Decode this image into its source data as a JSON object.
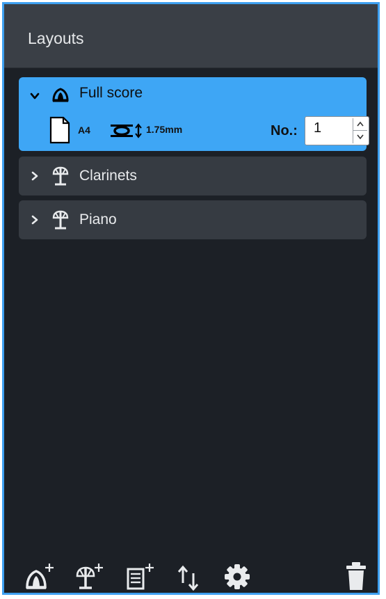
{
  "panel": {
    "title": "Layouts"
  },
  "layouts": [
    {
      "name": "Full score",
      "expanded": true,
      "selected": true,
      "icon": "full-score-icon",
      "page_size": "A4",
      "staff_size": "1.75mm",
      "number_label": "No.:",
      "number_value": "1"
    },
    {
      "name": "Clarinets",
      "expanded": false,
      "selected": false,
      "icon": "part-layout-icon"
    },
    {
      "name": "Piano",
      "expanded": false,
      "selected": false,
      "icon": "part-layout-icon"
    }
  ],
  "toolbar": {
    "buttons": [
      {
        "name": "add-full-score-layout-button",
        "icon": "add-full-score-icon"
      },
      {
        "name": "add-part-layout-button",
        "icon": "add-part-icon"
      },
      {
        "name": "add-custom-layout-button",
        "icon": "add-custom-layout-icon"
      },
      {
        "name": "sort-layouts-button",
        "icon": "sort-icon"
      },
      {
        "name": "layout-options-button",
        "icon": "gear-icon"
      },
      {
        "name": "delete-layout-button",
        "icon": "trash-icon"
      }
    ]
  },
  "colors": {
    "accent": "#3ea6f5",
    "panel_bg": "#1c2026",
    "header_bg": "#3a3f46",
    "row_bg": "#363b42"
  }
}
